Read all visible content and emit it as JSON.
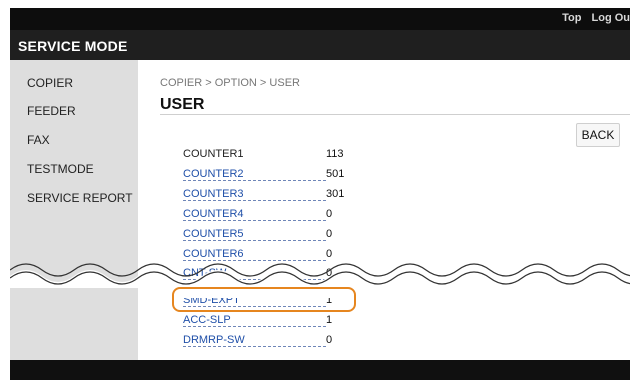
{
  "header": {
    "links": [
      "Top",
      "Log Ou"
    ],
    "title": "SERVICE MODE"
  },
  "sidebar": {
    "items": [
      "COPIER",
      "FEEDER",
      "FAX",
      "TESTMODE",
      "SERVICE REPORT"
    ]
  },
  "main": {
    "breadcrumb": "COPIER > OPTION > USER",
    "title": "USER",
    "back_label": "BACK",
    "rows": [
      {
        "label": "COUNTER1",
        "value": "113"
      },
      {
        "label": "COUNTER2",
        "value": "501"
      },
      {
        "label": "COUNTER3",
        "value": "301"
      },
      {
        "label": "COUNTER4",
        "value": "0"
      },
      {
        "label": "COUNTER5",
        "value": "0"
      },
      {
        "label": "COUNTER6",
        "value": "0"
      },
      {
        "label": "CNT-SW",
        "value": "0"
      },
      {
        "label": "SMD-EXPT",
        "value": "1"
      },
      {
        "label": "ACC-SLP",
        "value": "1"
      },
      {
        "label": "DRMRP-SW",
        "value": "0"
      }
    ]
  },
  "colors": {
    "highlight": "#e6861f",
    "link": "#1f4fa8"
  }
}
